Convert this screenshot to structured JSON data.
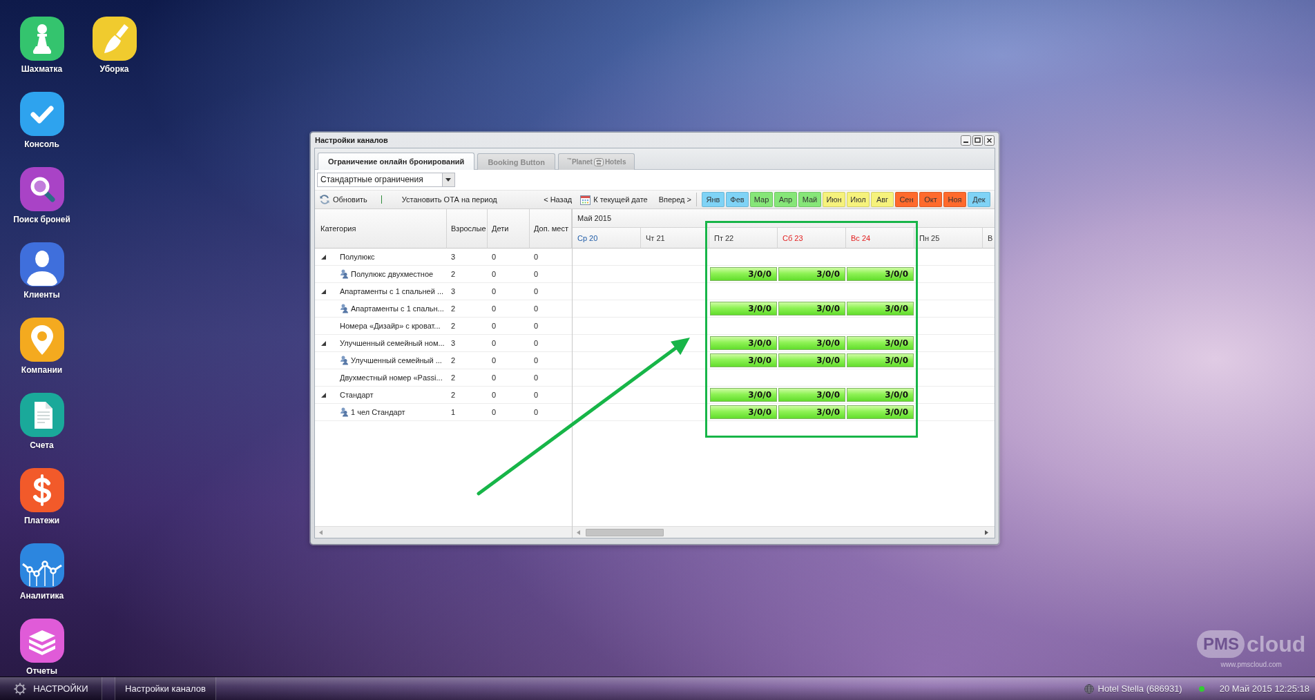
{
  "desktop_icons": [
    {
      "label": "Шахматка",
      "kind": "pawn",
      "color": "#34c46e"
    },
    {
      "label": "Консоль",
      "kind": "check",
      "color": "#2ea3ee"
    },
    {
      "label": "Поиск броней",
      "kind": "search",
      "color": "#a943c6"
    },
    {
      "label": "Клиенты",
      "kind": "person",
      "color": "#3f6fdc"
    },
    {
      "label": "Компании",
      "kind": "pin",
      "color": "#f4aa1f"
    },
    {
      "label": "Счета",
      "kind": "document",
      "color": "#1aa99a"
    },
    {
      "label": "Платежи",
      "kind": "dollar",
      "color": "#f25a2a"
    },
    {
      "label": "Аналитика",
      "kind": "chart",
      "color": "#2c86df"
    },
    {
      "label": "Отчеты",
      "kind": "books",
      "color": "#e05bd8"
    },
    {
      "label": "Уборка",
      "kind": "broom",
      "color": "#f0cb2e"
    }
  ],
  "window": {
    "title": "Настройки каналов"
  },
  "tabs": [
    {
      "kind": "text",
      "label": "Ограничение онлайн бронирований",
      "selected": true
    },
    {
      "kind": "text",
      "label": "Booking Button",
      "selected": false
    },
    {
      "kind": "logo",
      "label": "$^{™}$Planet",
      "label_after_icon": "Hotels",
      "selected": false
    }
  ],
  "restriction_dropdown": {
    "value": "Стандартные ограничения"
  },
  "toolbar": {
    "refresh": "Обновить",
    "set_ota": "Установить ОТА на период",
    "back": "< Назад",
    "today": "К текущей дате",
    "forward": "Вперед >"
  },
  "months": [
    {
      "label": "Янв",
      "color": "#7fd3f6"
    },
    {
      "label": "Фев",
      "color": "#7fd3f6"
    },
    {
      "label": "Мар",
      "color": "#86e678"
    },
    {
      "label": "Апр",
      "color": "#86e678"
    },
    {
      "label": "Май",
      "color": "#86e678"
    },
    {
      "label": "Июн",
      "color": "#f6f27c"
    },
    {
      "label": "Июл",
      "color": "#f6f27c"
    },
    {
      "label": "Авг",
      "color": "#f6f27c"
    },
    {
      "label": "Сен",
      "color": "#ff6a2c"
    },
    {
      "label": "Окт",
      "color": "#ff6a2c"
    },
    {
      "label": "Ноя",
      "color": "#ff6a2c"
    },
    {
      "label": "Дек",
      "color": "#7fd3f6"
    }
  ],
  "grid": {
    "columns": [
      "Категория",
      "Взрослые",
      "Дети",
      "Доп. мест"
    ],
    "period": "Май 2015",
    "days": [
      {
        "label": "Ср 20",
        "color": "#1f5ca8"
      },
      {
        "label": "Чт 21",
        "color": "#333333"
      },
      {
        "label": "Пт 22",
        "color": "#333333"
      },
      {
        "label": "Сб 23",
        "color": "#e21c1c"
      },
      {
        "label": "Вс 24",
        "color": "#e21c1c"
      },
      {
        "label": "Пн 25",
        "color": "#333333"
      },
      {
        "label": "В",
        "color": "#333333"
      }
    ],
    "rows": [
      {
        "kind": "group",
        "category": "Полулюкс",
        "adults": "3",
        "kids": "0",
        "extra_beds": "0",
        "expanded": true,
        "children": [
          {
            "category": "Полулюкс двухместное",
            "adults": "2",
            "kids": "0",
            "extra_beds": "0",
            "availability": [
              {
                "kind": "empty"
              },
              {
                "kind": "empty"
              },
              {
                "kind": "quota",
                "text": "3/0/0"
              },
              {
                "kind": "quota",
                "text": "3/0/0"
              },
              {
                "kind": "quota",
                "text": "3/0/0"
              },
              {
                "kind": "empty"
              },
              {
                "kind": "empty"
              }
            ]
          }
        ]
      },
      {
        "kind": "group",
        "category": "Апартаменты с 1 спальней ...",
        "adults": "3",
        "kids": "0",
        "extra_beds": "0",
        "expanded": true,
        "children": [
          {
            "category": "Апартаменты с 1 спальн...",
            "adults": "2",
            "kids": "0",
            "extra_beds": "0",
            "availability": [
              {
                "kind": "empty"
              },
              {
                "kind": "empty"
              },
              {
                "kind": "quota",
                "text": "3/0/0"
              },
              {
                "kind": "quota",
                "text": "3/0/0"
              },
              {
                "kind": "quota",
                "text": "3/0/0"
              },
              {
                "kind": "empty"
              },
              {
                "kind": "empty"
              }
            ]
          }
        ]
      },
      {
        "kind": "leaf",
        "category": "Номера «Дизайр» с кроват...",
        "adults": "2",
        "kids": "0",
        "extra_beds": "0"
      },
      {
        "kind": "group",
        "category": "Улучшенный семейный ном...",
        "adults": "3",
        "kids": "0",
        "extra_beds": "0",
        "expanded": true,
        "availability": [
          {
            "kind": "empty"
          },
          {
            "kind": "empty"
          },
          {
            "kind": "quota",
            "text": "3/0/0"
          },
          {
            "kind": "quota",
            "text": "3/0/0"
          },
          {
            "kind": "quota",
            "text": "3/0/0"
          },
          {
            "kind": "empty"
          },
          {
            "kind": "empty"
          }
        ],
        "children": [
          {
            "category": "Улучшенный семейный ...",
            "adults": "2",
            "kids": "0",
            "extra_beds": "0",
            "availability": [
              {
                "kind": "empty"
              },
              {
                "kind": "empty"
              },
              {
                "kind": "quota",
                "text": "3/0/0"
              },
              {
                "kind": "quota",
                "text": "3/0/0"
              },
              {
                "kind": "quota",
                "text": "3/0/0"
              },
              {
                "kind": "empty"
              },
              {
                "kind": "empty"
              }
            ]
          }
        ]
      },
      {
        "kind": "leaf",
        "category": "Двухместный номер «Passi...",
        "adults": "2",
        "kids": "0",
        "extra_beds": "0"
      },
      {
        "kind": "group",
        "category": "Стандарт",
        "adults": "2",
        "kids": "0",
        "extra_beds": "0",
        "expanded": true,
        "availability": [
          {
            "kind": "empty"
          },
          {
            "kind": "empty"
          },
          {
            "kind": "quota",
            "text": "3/0/0"
          },
          {
            "kind": "quota",
            "text": "3/0/0"
          },
          {
            "kind": "quota",
            "text": "3/0/0"
          },
          {
            "kind": "empty"
          },
          {
            "kind": "empty"
          }
        ],
        "children": [
          {
            "category": "1 чел Стандарт",
            "adults": "1",
            "kids": "0",
            "extra_beds": "0",
            "availability": [
              {
                "kind": "empty"
              },
              {
                "kind": "empty"
              },
              {
                "kind": "quota",
                "text": "3/0/0"
              },
              {
                "kind": "quota",
                "text": "3/0/0"
              },
              {
                "kind": "quota",
                "text": "3/0/0"
              },
              {
                "kind": "empty"
              },
              {
                "kind": "empty"
              }
            ]
          }
        ]
      }
    ]
  },
  "brand_logo": {
    "badge": "PMS",
    "wordmark": "cloud",
    "url": "www.pmscloud.com"
  },
  "annotations": {
    "highlight_frame": true,
    "pointer_arrow": true
  },
  "taskbar": {
    "start_button": "НАСТРОЙКИ",
    "tasks": [
      "Настройки каналов"
    ],
    "hotel": "Hotel Stella (686931)",
    "connection_status": {
      "color": "#33cc33"
    },
    "clock": "20 Май 2015 12:25:18"
  }
}
